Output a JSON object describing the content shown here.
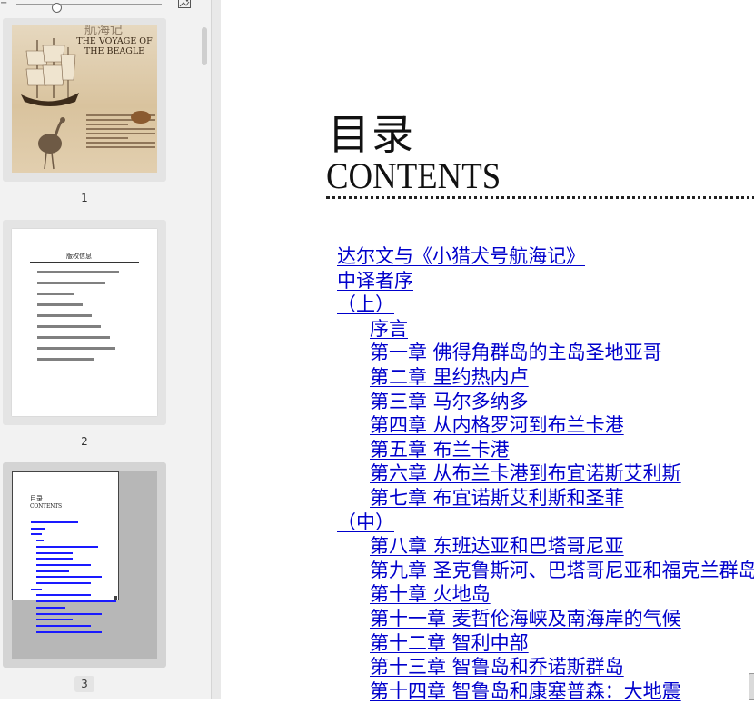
{
  "sidebar": {
    "thumbnails": [
      {
        "page_number": "1",
        "cover": {
          "title_en": "THE VOYAGE OF THE BEAGLE",
          "title_cn_partial": "航海记"
        }
      },
      {
        "page_number": "2",
        "heading": "版权信息"
      },
      {
        "page_number": "3",
        "heading_cn": "目录",
        "heading_en": "CONTENTS"
      }
    ]
  },
  "document": {
    "title_cn": "目录",
    "title_en": "CONTENTS",
    "toc": [
      {
        "label": "达尔文与《小猎犬号航海记》"
      },
      {
        "label": "中译者序"
      },
      {
        "label": "（上）"
      },
      {
        "label": "序言"
      },
      {
        "label": "第一章  佛得角群岛的主岛圣地亚哥"
      },
      {
        "label": "第二章  里约热内卢"
      },
      {
        "label": "第三章  马尔多纳多"
      },
      {
        "label": "第四章  从内格罗河到布兰卡港"
      },
      {
        "label": "第五章  布兰卡港"
      },
      {
        "label": "第六章  从布兰卡港到布宜诺斯艾利斯"
      },
      {
        "label": "第七章  布宜诺斯艾利斯和圣菲"
      },
      {
        "label": "（中）"
      },
      {
        "label": "第八章  东班达亚和巴塔哥尼亚"
      },
      {
        "label": "第九章  圣克鲁斯河、巴塔哥尼亚和福克兰群岛"
      },
      {
        "label": "第十章  火地岛"
      },
      {
        "label": "第十一章  麦哲伦海峡及南海岸的气候"
      },
      {
        "label": "第十二章  智利中部"
      },
      {
        "label": "第十三章  智鲁岛和乔诺斯群岛"
      },
      {
        "label": "第十四章  智鲁岛和康塞普森：大地震"
      }
    ]
  },
  "colors": {
    "link": "#0000cc",
    "sidebar_bg": "#f2f2f2",
    "selected_thumb_bg": "#b7b7b7"
  }
}
